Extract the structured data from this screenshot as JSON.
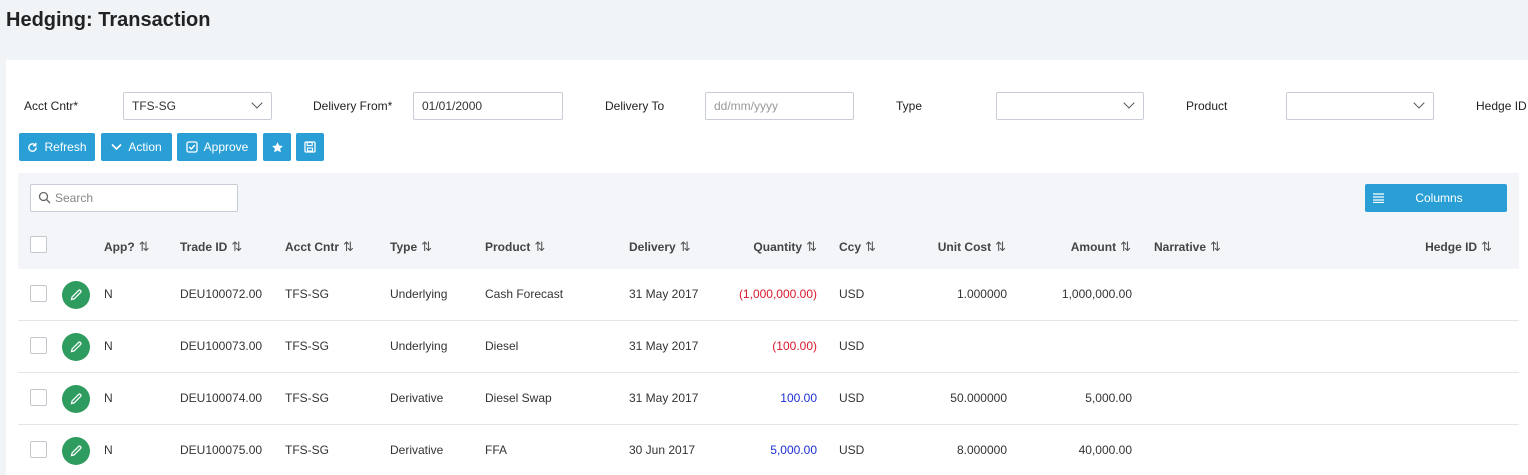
{
  "page": {
    "title": "Hedging: Transaction"
  },
  "filters": {
    "acct_cntr_label": "Acct Cntr*",
    "acct_cntr_value": "TFS-SG",
    "delivery_from_label": "Delivery From*",
    "delivery_from_value": "01/01/2000",
    "delivery_to_label": "Delivery To",
    "delivery_to_placeholder": "dd/mm/yyyy",
    "type_label": "Type",
    "type_value": "",
    "product_label": "Product",
    "product_value": "",
    "hedge_id_label": "Hedge ID"
  },
  "toolbar": {
    "refresh": "Refresh",
    "action": "Action",
    "approve": "Approve"
  },
  "grid": {
    "search_placeholder": "Search",
    "columns_button": "Columns",
    "headers": {
      "app": "App?",
      "trade_id": "Trade ID",
      "acct_cntr": "Acct Cntr",
      "type": "Type",
      "product": "Product",
      "delivery": "Delivery",
      "quantity": "Quantity",
      "ccy": "Ccy",
      "unit_cost": "Unit Cost",
      "amount": "Amount",
      "narrative": "Narrative",
      "hedge_id": "Hedge ID"
    },
    "sort_glyph": "⇅",
    "rows": [
      {
        "app": "N",
        "trade_id": "DEU100072.00",
        "acct_cntr": "TFS-SG",
        "type": "Underlying",
        "product": "Cash Forecast",
        "delivery": "31 May 2017",
        "quantity": "(1,000,000.00)",
        "quantity_sign": "neg",
        "ccy": "USD",
        "unit_cost": "1.000000",
        "amount": "1,000,000.00",
        "narrative": "",
        "hedge_id": ""
      },
      {
        "app": "N",
        "trade_id": "DEU100073.00",
        "acct_cntr": "TFS-SG",
        "type": "Underlying",
        "product": "Diesel",
        "delivery": "31 May 2017",
        "quantity": "(100.00)",
        "quantity_sign": "neg",
        "ccy": "USD",
        "unit_cost": "",
        "amount": "",
        "narrative": "",
        "hedge_id": ""
      },
      {
        "app": "N",
        "trade_id": "DEU100074.00",
        "acct_cntr": "TFS-SG",
        "type": "Derivative",
        "product": "Diesel Swap",
        "delivery": "31 May 2017",
        "quantity": "100.00",
        "quantity_sign": "pos",
        "ccy": "USD",
        "unit_cost": "50.000000",
        "amount": "5,000.00",
        "narrative": "",
        "hedge_id": ""
      },
      {
        "app": "N",
        "trade_id": "DEU100075.00",
        "acct_cntr": "TFS-SG",
        "type": "Derivative",
        "product": "FFA",
        "delivery": "30 Jun 2017",
        "quantity": "5,000.00",
        "quantity_sign": "pos",
        "ccy": "USD",
        "unit_cost": "8.000000",
        "amount": "40,000.00",
        "narrative": "",
        "hedge_id": ""
      }
    ]
  },
  "colors": {
    "accent": "#2a9fd6",
    "edit": "#2e9b5f",
    "negative": "#d9182b",
    "positive": "#1c2fd4"
  }
}
